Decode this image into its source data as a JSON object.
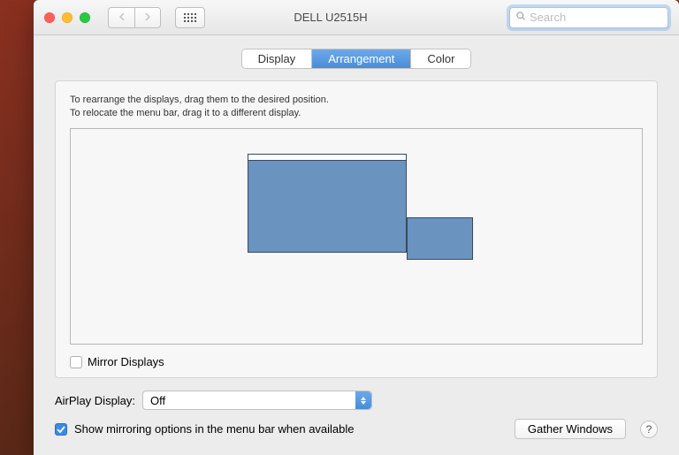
{
  "window": {
    "title": "DELL U2515H",
    "search_placeholder": "Search"
  },
  "tabs": {
    "display": "Display",
    "arrangement": "Arrangement",
    "color": "Color",
    "active": "arrangement"
  },
  "instructions": {
    "line1": "To rearrange the displays, drag them to the desired position.",
    "line2": "To relocate the menu bar, drag it to a different display."
  },
  "mirror": {
    "label": "Mirror Displays",
    "checked": false
  },
  "airplay": {
    "label": "AirPlay Display:",
    "value": "Off"
  },
  "show_mirroring": {
    "label": "Show mirroring options in the menu bar when available",
    "checked": true
  },
  "gather_windows": "Gather Windows",
  "help_tooltip": "?"
}
